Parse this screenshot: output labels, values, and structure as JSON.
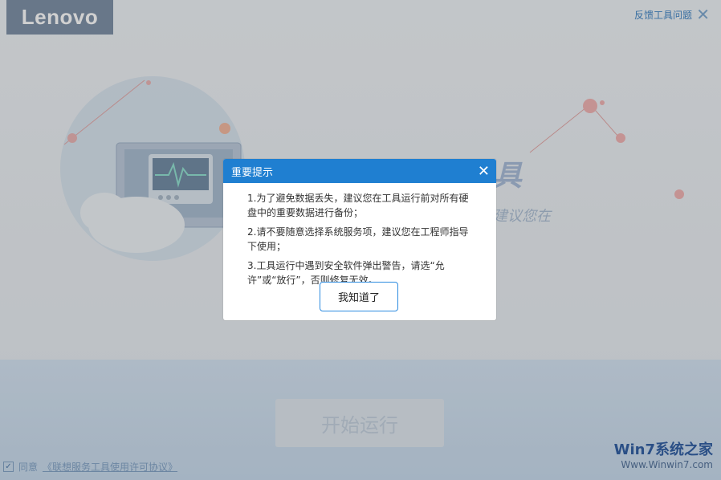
{
  "app": {
    "brand": "Lenovo",
    "feedback_label": "反馈工具问题",
    "hero_title": "…修复工具",
    "hero_subtitle": "…系统服务功能，建议您在",
    "start_button": "开始运行",
    "agreement": {
      "prefix": "同意",
      "link": "《联想服务工具使用许可协议》"
    },
    "watermark": {
      "name": "Win7系统之家",
      "url": "Www.Winwin7.com"
    }
  },
  "dialog": {
    "title": "重要提示",
    "items": [
      "1.为了避免数据丢失，建议您在工具运行前对所有硬盘中的重要数据进行备份；",
      "2.请不要随意选择系统服务项，建议您在工程师指导下使用；",
      "3.工具运行中遇到安全软件弹出警告，请选“允许”或“放行”，否则修复无效。"
    ],
    "ok_button": "我知道了"
  },
  "colors": {
    "dialog_header": "#1f7fd1",
    "ok_border": "#2c8be0"
  }
}
